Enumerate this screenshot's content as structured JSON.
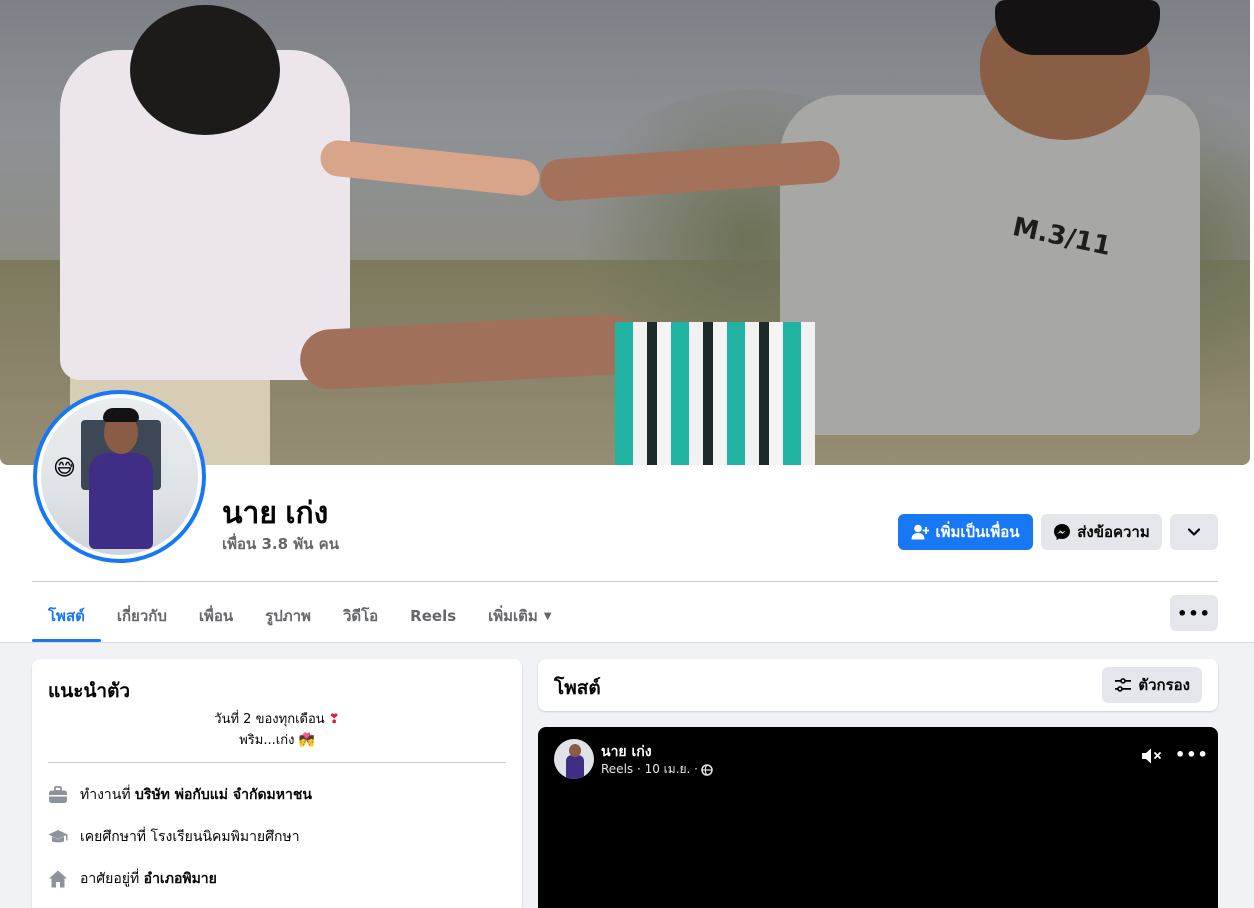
{
  "profile": {
    "name": "นาย เก่ง",
    "friends": "เพื่อน 3.8 พัน คน",
    "cover_shirt_text": "M.3/11"
  },
  "actions": {
    "add_friend": "เพิ่มเป็นเพื่อน",
    "message": "ส่งข้อความ"
  },
  "tabs": [
    {
      "label": "โพสต์",
      "active": true
    },
    {
      "label": "เกี่ยวกับ"
    },
    {
      "label": "เพื่อน"
    },
    {
      "label": "รูปภาพ"
    },
    {
      "label": "วิดีโอ"
    },
    {
      "label": "Reels"
    },
    {
      "label": "เพิ่มเติม"
    }
  ],
  "intro": {
    "title": "แนะนำตัว",
    "bio_line1": "วันที่ 2 ของทุกเดือน",
    "bio_line2": "พริม...เก่ง",
    "work_prefix": "ทำงานที่",
    "work_value": "บริษัท พ่อกับแม่ จำกัดมหาชน",
    "study_prefix": "เคยศึกษาที่",
    "study_value": "โรงเรียนนิคมพิมายศึกษา",
    "lives_prefix": "อาศัยอยู่ที่",
    "lives_value": "อำเภอพิมาย"
  },
  "posts": {
    "title": "โพสต์",
    "filter_label": "ตัวกรอง"
  },
  "post": {
    "author": "นาย เก่ง",
    "meta": "Reels · 10 เม.ย. ·"
  },
  "colors": {
    "accent": "#1877f2",
    "secondary_button": "#e4e6eb",
    "muted_text": "#65676b",
    "page_background": "#f0f2f5"
  }
}
